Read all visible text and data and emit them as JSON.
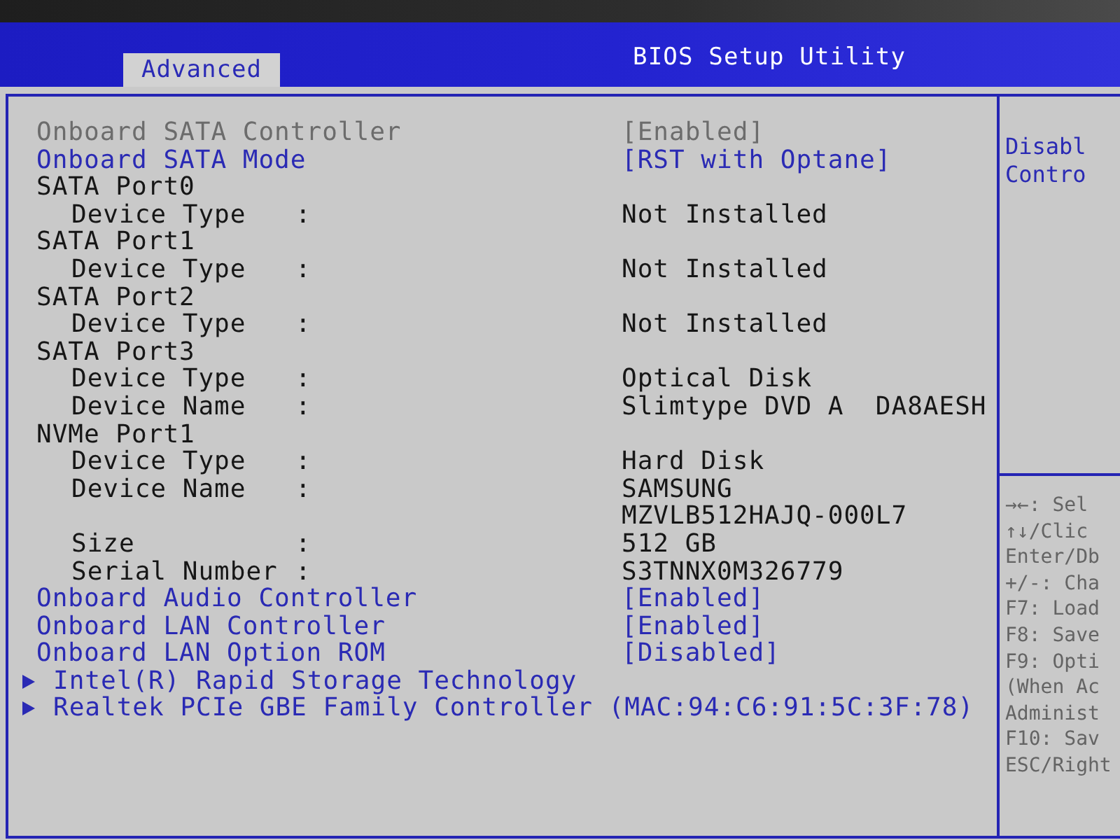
{
  "header": {
    "tabs": [
      {
        "label": "Advanced",
        "selected": true
      }
    ],
    "title": "BIOS Setup Utility"
  },
  "items": [
    {
      "kind": "setting",
      "label": "Onboard SATA Controller",
      "value": "[Enabled]",
      "disabled": true
    },
    {
      "kind": "setting",
      "label": "Onboard SATA Mode",
      "value": "[RST with Optane]",
      "disabled": false
    },
    {
      "kind": "group",
      "label": "SATA Port0",
      "children": [
        {
          "kind": "info",
          "label": "Device Type",
          "separator": ":",
          "value": "Not Installed"
        }
      ]
    },
    {
      "kind": "group",
      "label": "SATA Port1",
      "children": [
        {
          "kind": "info",
          "label": "Device Type",
          "separator": ":",
          "value": "Not Installed"
        }
      ]
    },
    {
      "kind": "group",
      "label": "SATA Port2",
      "children": [
        {
          "kind": "info",
          "label": "Device Type",
          "separator": ":",
          "value": "Not Installed"
        }
      ]
    },
    {
      "kind": "group",
      "label": "SATA Port3",
      "children": [
        {
          "kind": "info",
          "label": "Device Type",
          "separator": ":",
          "value": "Optical Disk"
        },
        {
          "kind": "info",
          "label": "Device Name",
          "separator": ":",
          "value": "Slimtype DVD A  DA8AESH"
        }
      ]
    },
    {
      "kind": "group",
      "label": "NVMe Port1",
      "children": [
        {
          "kind": "info",
          "label": "Device Type",
          "separator": ":",
          "value": "Hard Disk"
        },
        {
          "kind": "info",
          "label": "Device Name",
          "separator": ":",
          "value": "SAMSUNG"
        },
        {
          "kind": "info",
          "value": "MZVLB512HAJQ-000L7"
        },
        {
          "kind": "info",
          "label": "Size",
          "separator": ":",
          "value": "512 GB"
        },
        {
          "kind": "info",
          "label": "Serial Number",
          "separator": ":",
          "value": "S3TNNX0M326779"
        }
      ]
    },
    {
      "kind": "setting",
      "label": "Onboard Audio Controller",
      "value": "[Enabled]",
      "disabled": false
    },
    {
      "kind": "setting",
      "label": "Onboard LAN Controller",
      "value": "[Enabled]",
      "disabled": false
    },
    {
      "kind": "setting",
      "label": "Onboard LAN Option ROM",
      "value": "[Disabled]",
      "disabled": false
    },
    {
      "kind": "submenu",
      "label": "Intel(R) Rapid Storage Technology",
      "disabled": false
    },
    {
      "kind": "submenu",
      "label": "Realtek PCIe GBE Family Controller (MAC:94:C6:91:5C:3F:78)",
      "disabled": false
    }
  ],
  "help_panel": {
    "description": [
      "Disabl",
      "Contro"
    ],
    "key_hints": [
      "→←: Sel",
      "↑↓/Clic",
      "Enter/Db",
      "+/-: Cha",
      "F7: Load",
      "F8: Save",
      "F9: Opti",
      "(When Ac",
      "Administ",
      "F10: Sav",
      "ESC/Right"
    ]
  }
}
